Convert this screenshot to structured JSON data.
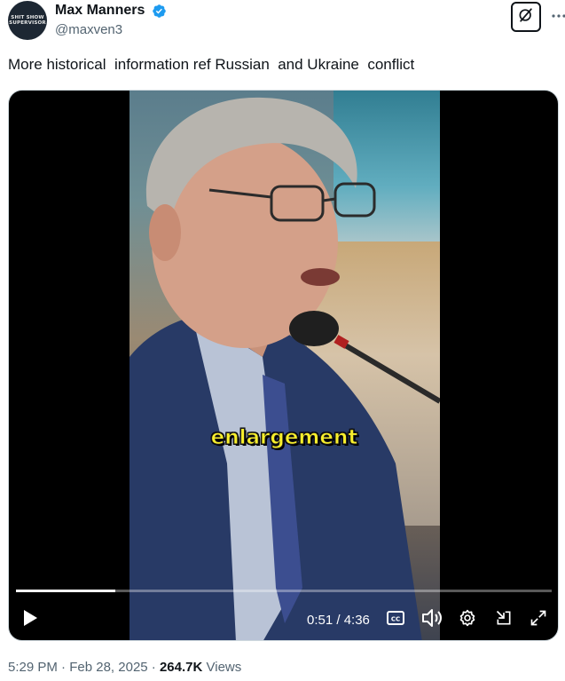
{
  "author": {
    "display_name": "Max Manners",
    "handle": "@maxven3",
    "avatar_text": "SHIT SHOW SUPERVISOR",
    "verified_icon": "verified-badge-icon"
  },
  "tweet": {
    "text": "More historical  information ref Russian  and Ukraine  conflict"
  },
  "video": {
    "caption": "enlargement",
    "time_display": "0:51 / 4:36",
    "progress": 0.185,
    "icons": [
      "play-icon",
      "closed-captions-icon",
      "volume-icon",
      "settings-icon",
      "dock-icon",
      "fullscreen-icon"
    ]
  },
  "meta": {
    "time": "5:29 PM",
    "date": "Feb 28, 2025",
    "separator": "·",
    "views_count": "264.7K",
    "views_label": "Views"
  },
  "colors": {
    "verified": "#1d9bf0",
    "caption": "#f8ef2c",
    "secondary_text": "#536471"
  }
}
